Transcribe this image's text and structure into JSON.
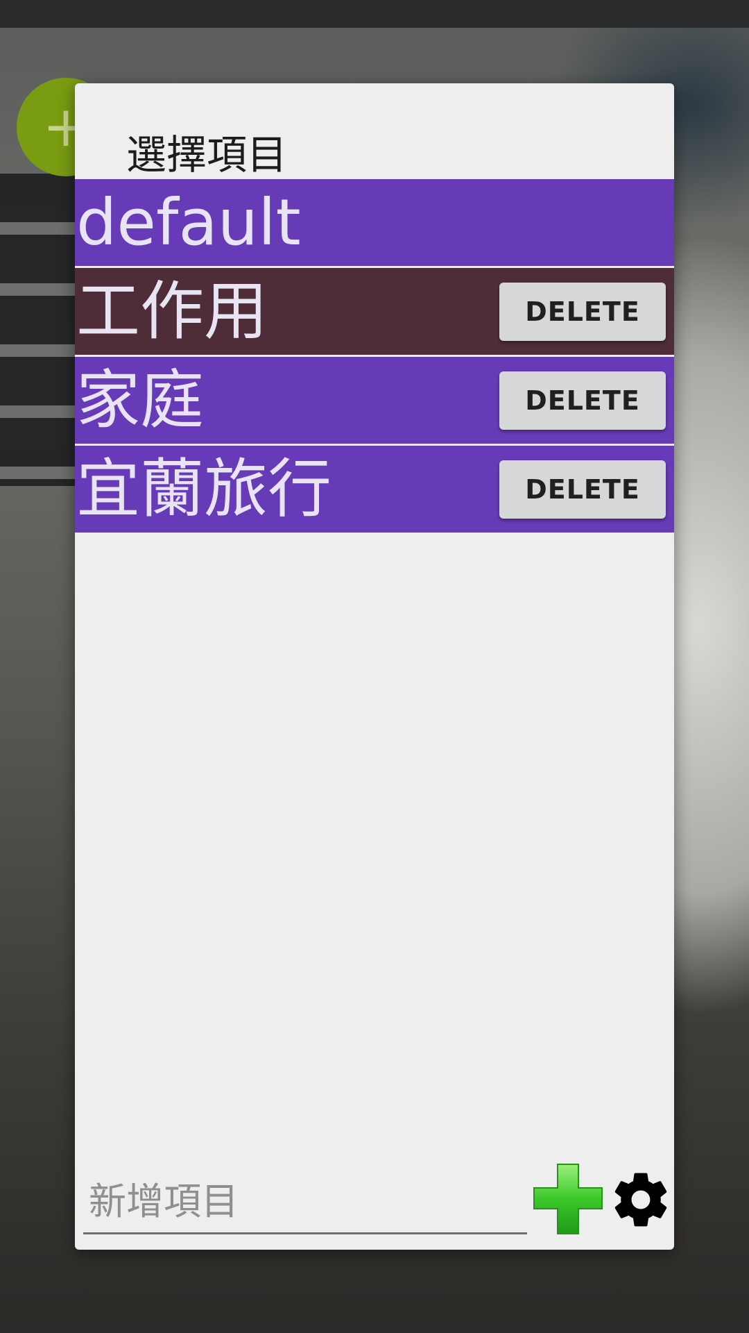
{
  "background": {
    "fab_symbol": "+"
  },
  "dialog": {
    "title": "選擇項目",
    "items": [
      {
        "label": "default",
        "color": "#673ab7",
        "has_delete": false
      },
      {
        "label": "工作用",
        "color": "#4e2c38",
        "has_delete": true
      },
      {
        "label": "家庭",
        "color": "#673ab7",
        "has_delete": true
      },
      {
        "label": "宜蘭旅行",
        "color": "#673ab7",
        "has_delete": true
      }
    ],
    "delete_label": "DELETE",
    "new_item_placeholder": "新增項目",
    "add_icon": "green-plus-icon",
    "settings_icon": "gear-icon"
  },
  "colors": {
    "item_purple": "#673ab7",
    "item_selected": "#4e2c38",
    "add_green": "#3cc82a"
  }
}
